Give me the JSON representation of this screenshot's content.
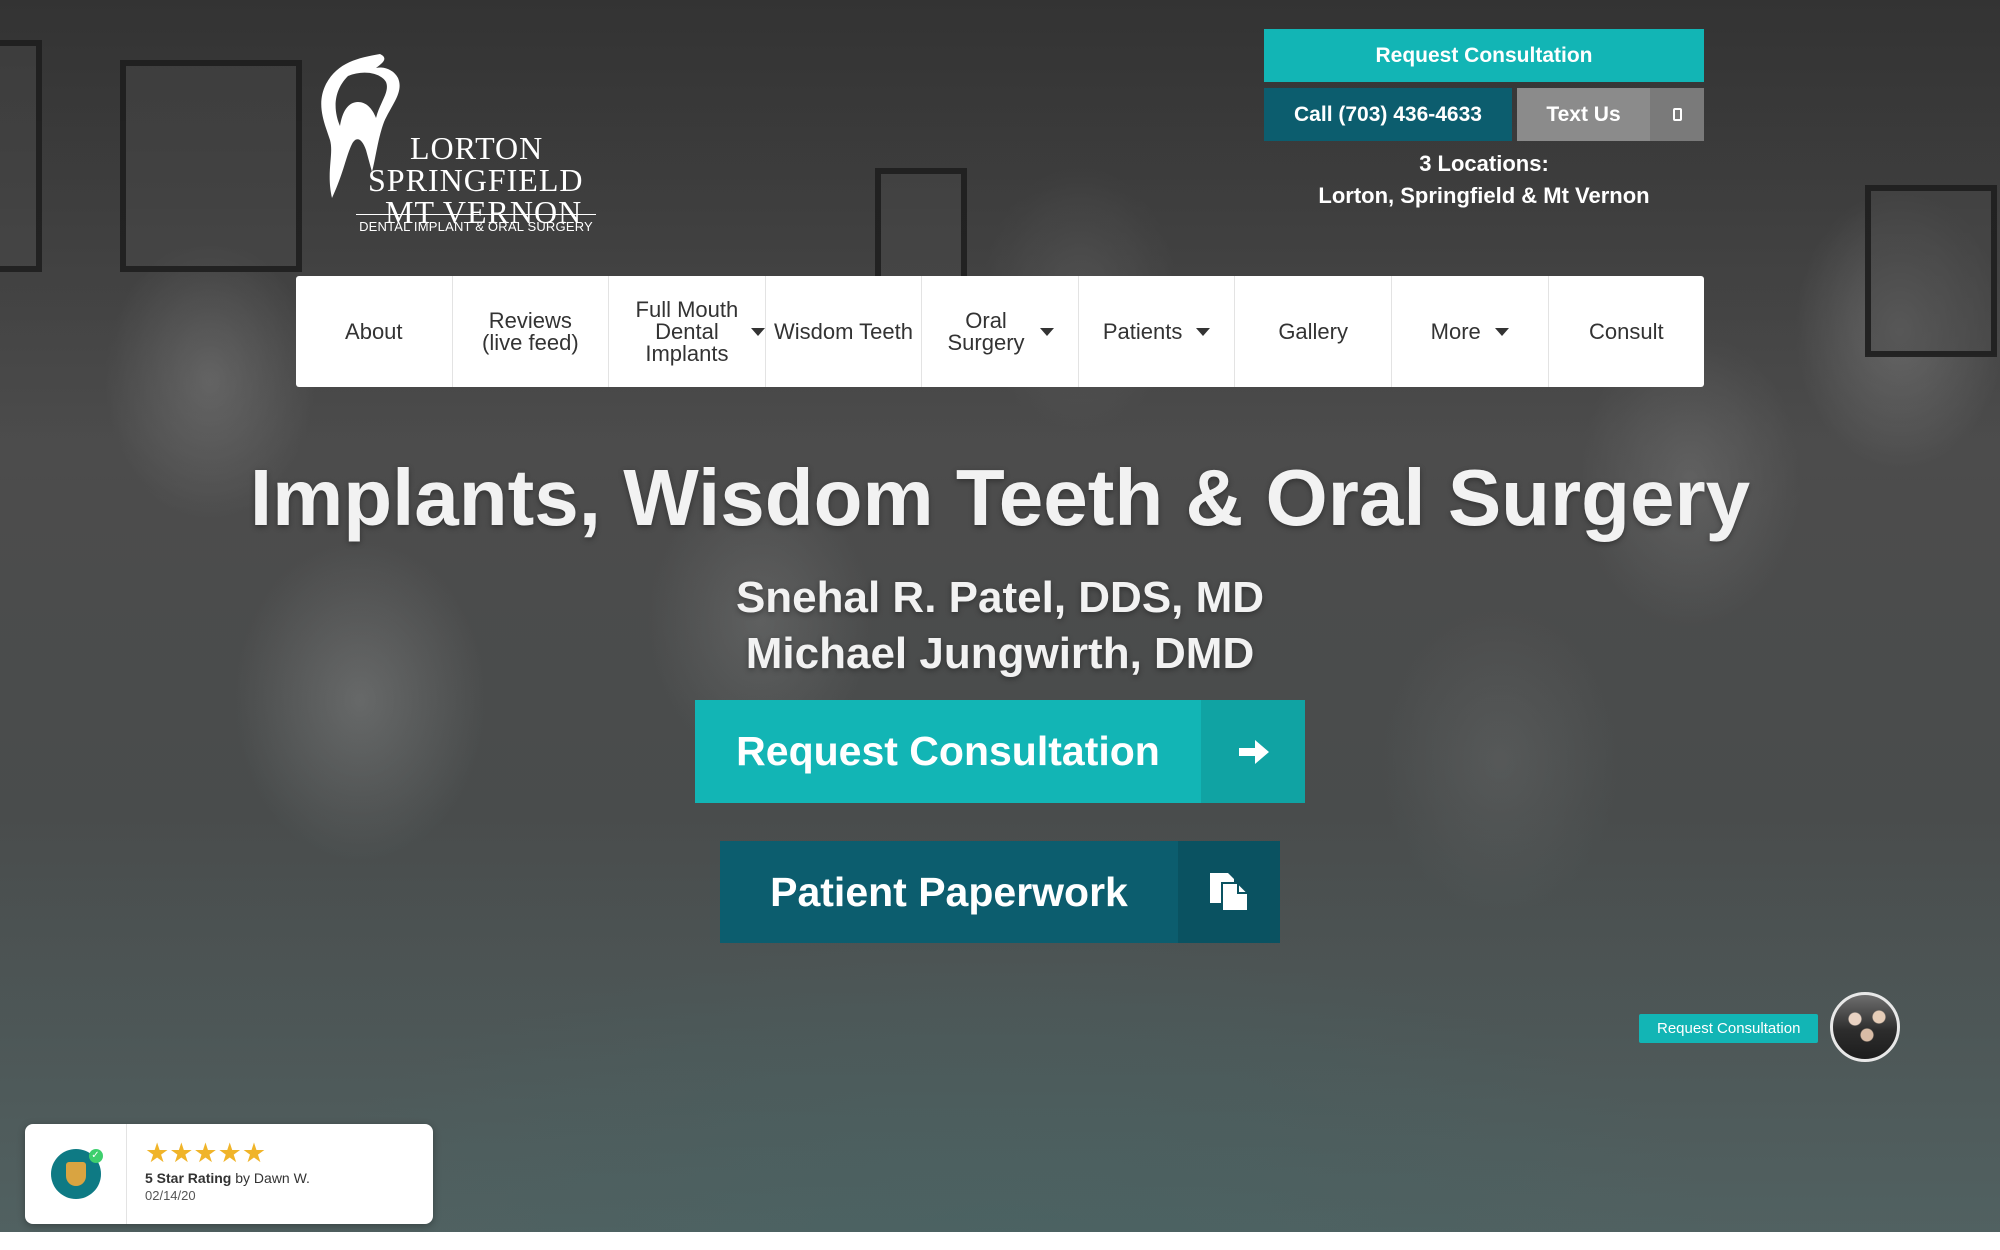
{
  "logo": {
    "line1": "LORTON",
    "line2": "SPRINGFIELD",
    "line3": "MT VERNON",
    "sub": "DENTAL IMPLANT & ORAL SURGERY"
  },
  "header": {
    "consult_label": "Request Consultation",
    "call_label": "Call (703) 436-4633",
    "text_label": "Text Us",
    "text_icon": "phone-icon",
    "locations_line1": "3 Locations:",
    "locations_line2": "Lorton, Springfield & Mt Vernon"
  },
  "nav": {
    "items": [
      {
        "label": "About",
        "dropdown": false
      },
      {
        "label": "Reviews (live feed)",
        "dropdown": false
      },
      {
        "label": "Full Mouth Dental Implants",
        "dropdown": true
      },
      {
        "label": "Wisdom Teeth",
        "dropdown": false
      },
      {
        "label": "Oral Surgery",
        "dropdown": true
      },
      {
        "label": "Patients",
        "dropdown": true
      },
      {
        "label": "Gallery",
        "dropdown": false
      },
      {
        "label": "More",
        "dropdown": true
      },
      {
        "label": "Consult",
        "dropdown": false
      }
    ]
  },
  "hero": {
    "title": "Implants, Wisdom Teeth & Oral Surgery",
    "doctor1": "Snehal R. Patel, DDS, MD",
    "doctor2": "Michael Jungwirth, DMD",
    "cta_consult": "Request Consultation",
    "cta_consult_icon": "arrow-right-icon",
    "cta_paperwork": "Patient Paperwork",
    "cta_paperwork_icon": "documents-icon"
  },
  "float_widget": {
    "label": "Request Consultation"
  },
  "review_badge": {
    "stars": "★★★★★",
    "rating_bold": "5 Star Rating",
    "rating_by": " by Dawn W.",
    "date": "02/14/20"
  },
  "colors": {
    "teal": "#12b5b5",
    "dark_teal": "#0c5d6e",
    "gray_button": "#8b8b8b",
    "star": "#f0b429"
  }
}
